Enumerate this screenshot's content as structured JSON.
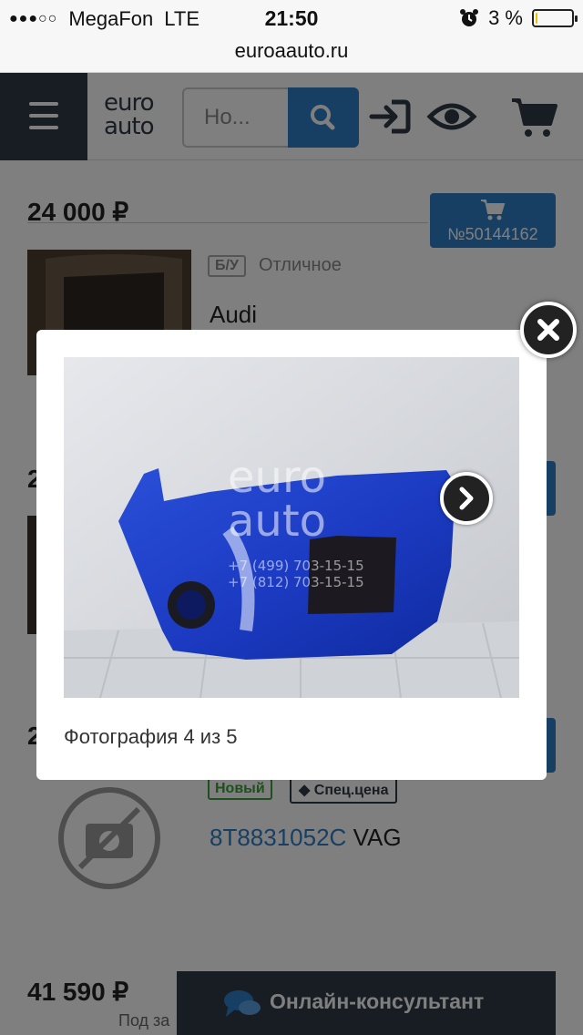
{
  "status_bar": {
    "signal": "●●●○○",
    "carrier": "MegaFon",
    "network": "LTE",
    "time": "21:50",
    "battery_text": "3 %",
    "battery_level": 0.03
  },
  "browser": {
    "url": "euroaauto.ru"
  },
  "header": {
    "logo_line1": "euro",
    "logo_line2": "auto",
    "search_placeholder": "Но..."
  },
  "listings": [
    {
      "price": "24 000 ₽",
      "cart_label": "№50144162",
      "badge": "Б/У",
      "condition": "Отличное",
      "brand": "Audi"
    },
    {
      "price_partial": "2"
    },
    {
      "price_partial": "2",
      "badge_new": "Новый",
      "badge_special": "Спец.цена",
      "part_number": "8T8831052C",
      "maker": "VAG"
    },
    {
      "price": "41 590 ₽",
      "note": "Под за"
    }
  ],
  "consultant": {
    "label": "Онлайн-консультант"
  },
  "modal": {
    "caption": "Фотография 4 из 5",
    "watermark_line1": "euro",
    "watermark_line2": "auto",
    "phone1": "+7 (499) 703-15-15",
    "phone2": "+7 (812) 703-15-15"
  },
  "colors": {
    "brand_dark": "#2f3a45",
    "accent_blue": "#2f7ec7",
    "badge_green": "#3aa03a",
    "badge_gray": "#888888"
  }
}
